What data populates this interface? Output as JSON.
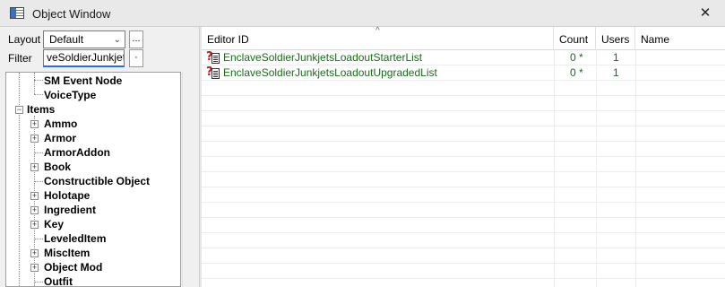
{
  "window": {
    "title": "Object Window",
    "close_glyph": "✕",
    "app_icon": "window-icon"
  },
  "toolbar": {
    "layout_label": "Layout",
    "layout_value": "Default",
    "layout_btn": "...",
    "filter_label": "Filter",
    "filter_value": "veSoldierJunkjets",
    "filter_btn": "·"
  },
  "tree": {
    "items": [
      {
        "label": "SM Event Node"
      },
      {
        "label": "VoiceType"
      },
      {
        "label": "Items",
        "expander": "−"
      },
      {
        "label": "Ammo",
        "expander": "+"
      },
      {
        "label": "Armor",
        "expander": "+"
      },
      {
        "label": "ArmorAddon"
      },
      {
        "label": "Book",
        "expander": "+"
      },
      {
        "label": "Constructible Object"
      },
      {
        "label": "Holotape",
        "expander": "+"
      },
      {
        "label": "Ingredient",
        "expander": "+"
      },
      {
        "label": "Key",
        "expander": "+"
      },
      {
        "label": "LeveledItem"
      },
      {
        "label": "MiscItem",
        "expander": "+"
      },
      {
        "label": "Object Mod",
        "expander": "+"
      },
      {
        "label": "Outfit"
      }
    ]
  },
  "grid": {
    "sort_indicator": "^",
    "columns": [
      "Editor ID",
      "Count",
      "Users",
      "Name"
    ],
    "rows": [
      {
        "editor_id": "EnclaveSoldierJunkjetsLoadoutStarterList",
        "count": "0 *",
        "users": "1",
        "name": ""
      },
      {
        "editor_id": "EnclaveSoldierJunkjetsLoadoutUpgradedList",
        "count": "0 *",
        "users": "1",
        "name": ""
      }
    ]
  }
}
